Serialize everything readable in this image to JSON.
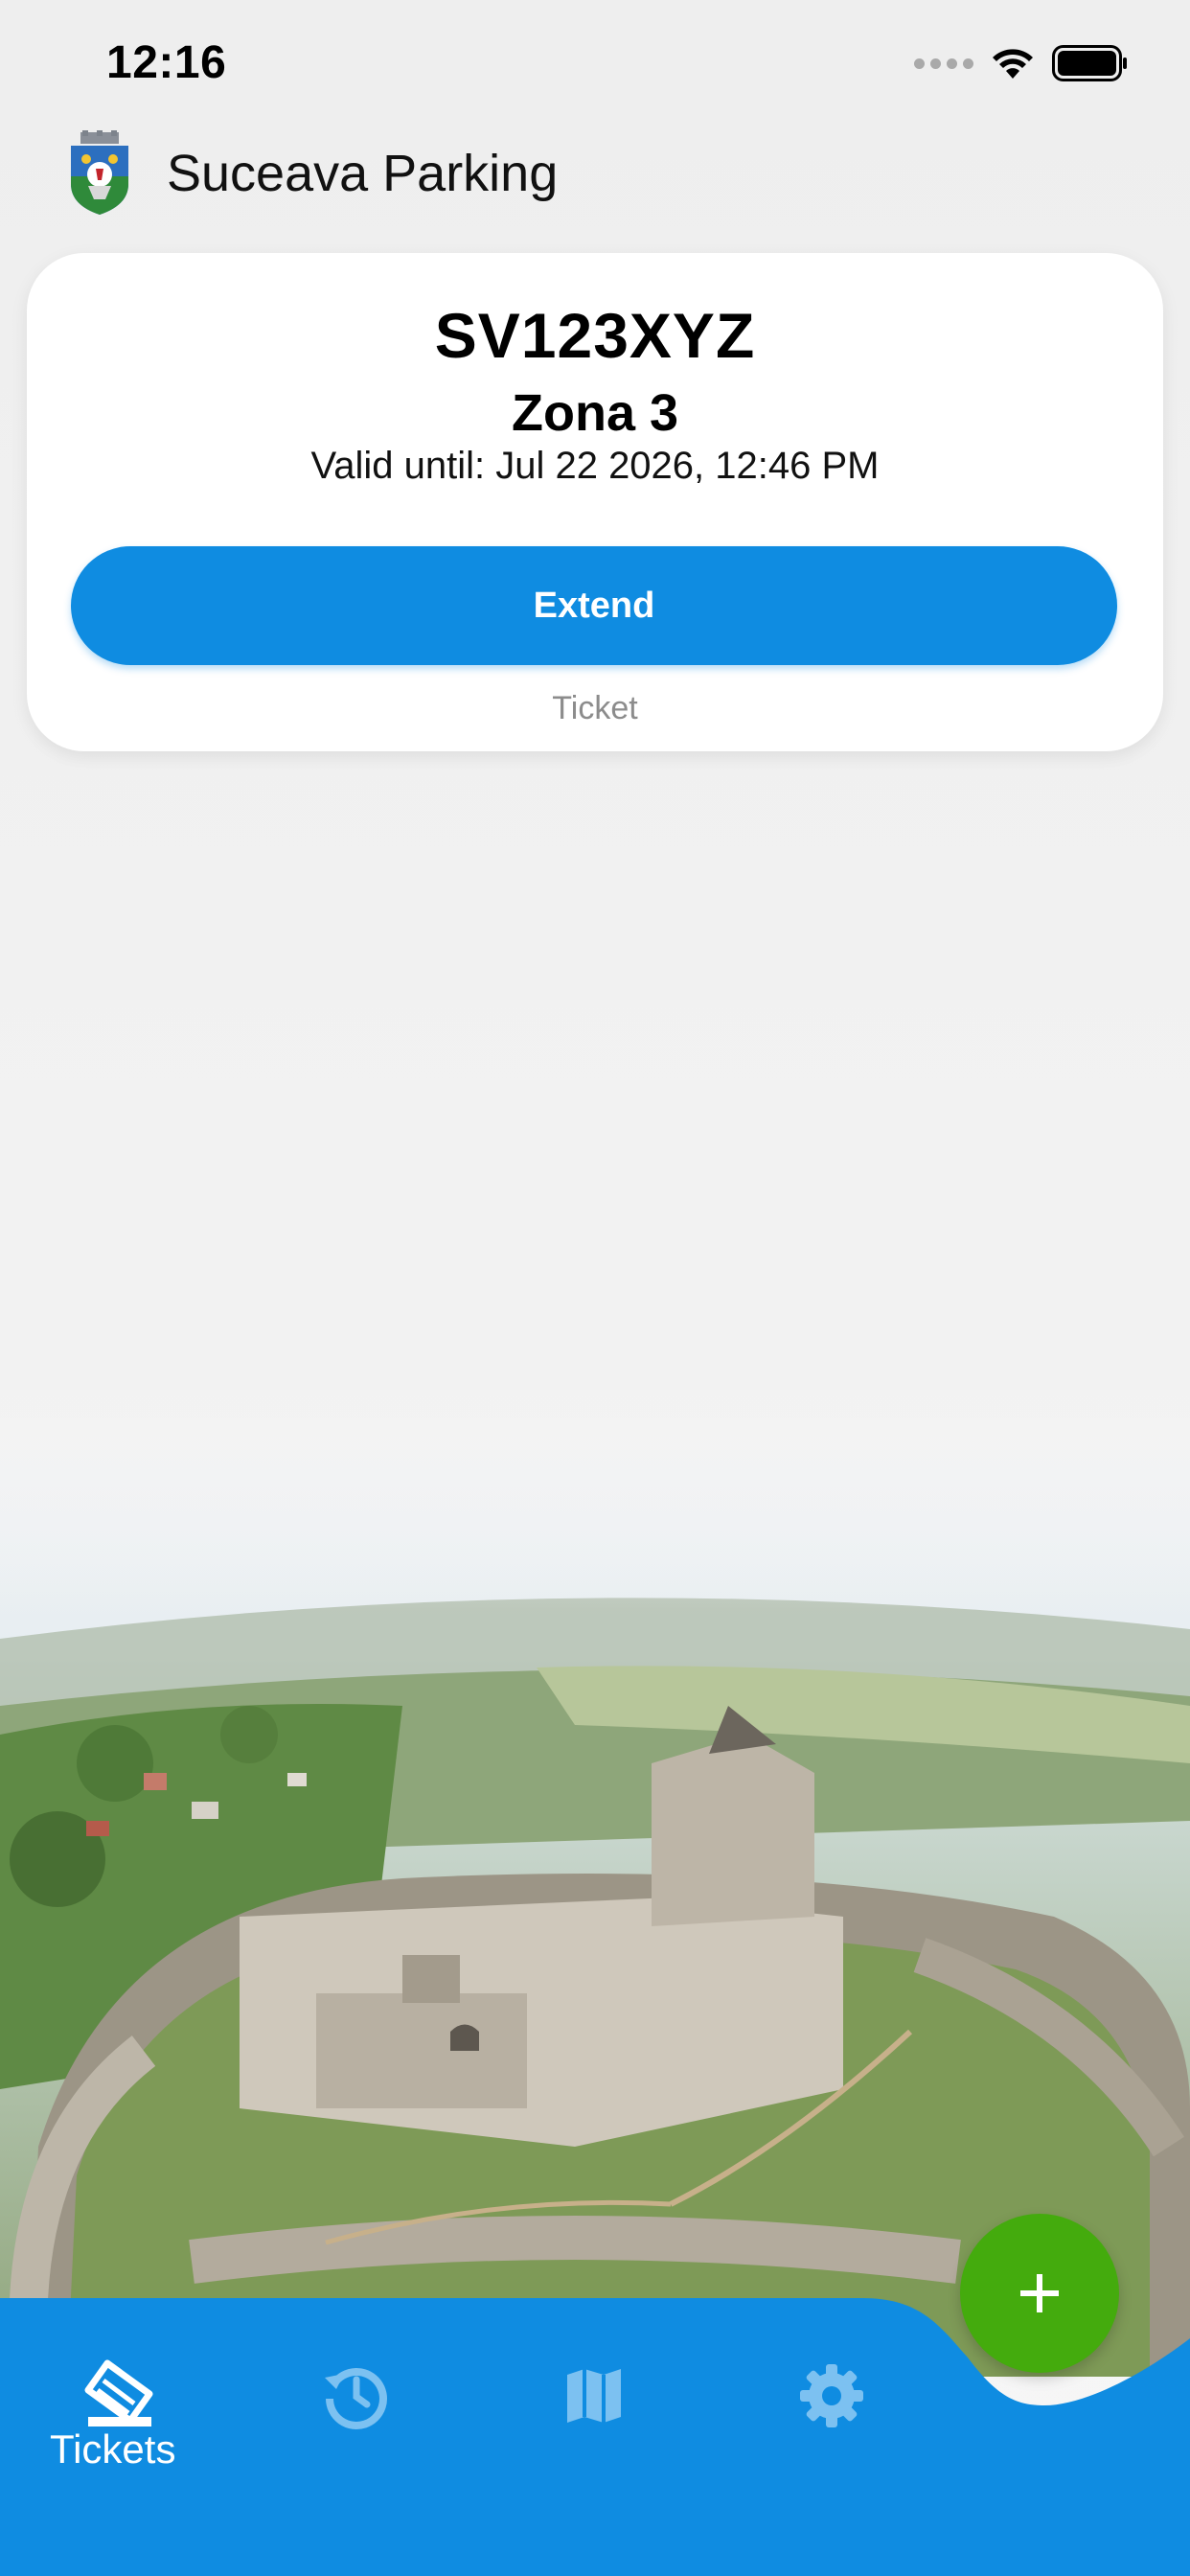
{
  "status_bar": {
    "time": "12:16"
  },
  "header": {
    "title": "Suceava Parking"
  },
  "ticket": {
    "plate": "SV123XYZ",
    "zone": "Zona 3",
    "valid_until": "Valid until: Jul 22 2026, 12:46 PM",
    "extend_label": "Extend",
    "label": "Ticket"
  },
  "nav": {
    "items": [
      {
        "label": "Tickets",
        "icon": "tickets-icon",
        "active": true
      },
      {
        "label": "",
        "icon": "history-icon",
        "active": false
      },
      {
        "label": "",
        "icon": "map-icon",
        "active": false
      },
      {
        "label": "",
        "icon": "gear-icon",
        "active": false
      }
    ]
  },
  "fab": {
    "icon": "plus-icon"
  },
  "colors": {
    "primary": "#0f8ce1",
    "fab": "#44ab0d",
    "nav_inactive_icon": "#7cc1f1",
    "background": "#efefef"
  }
}
